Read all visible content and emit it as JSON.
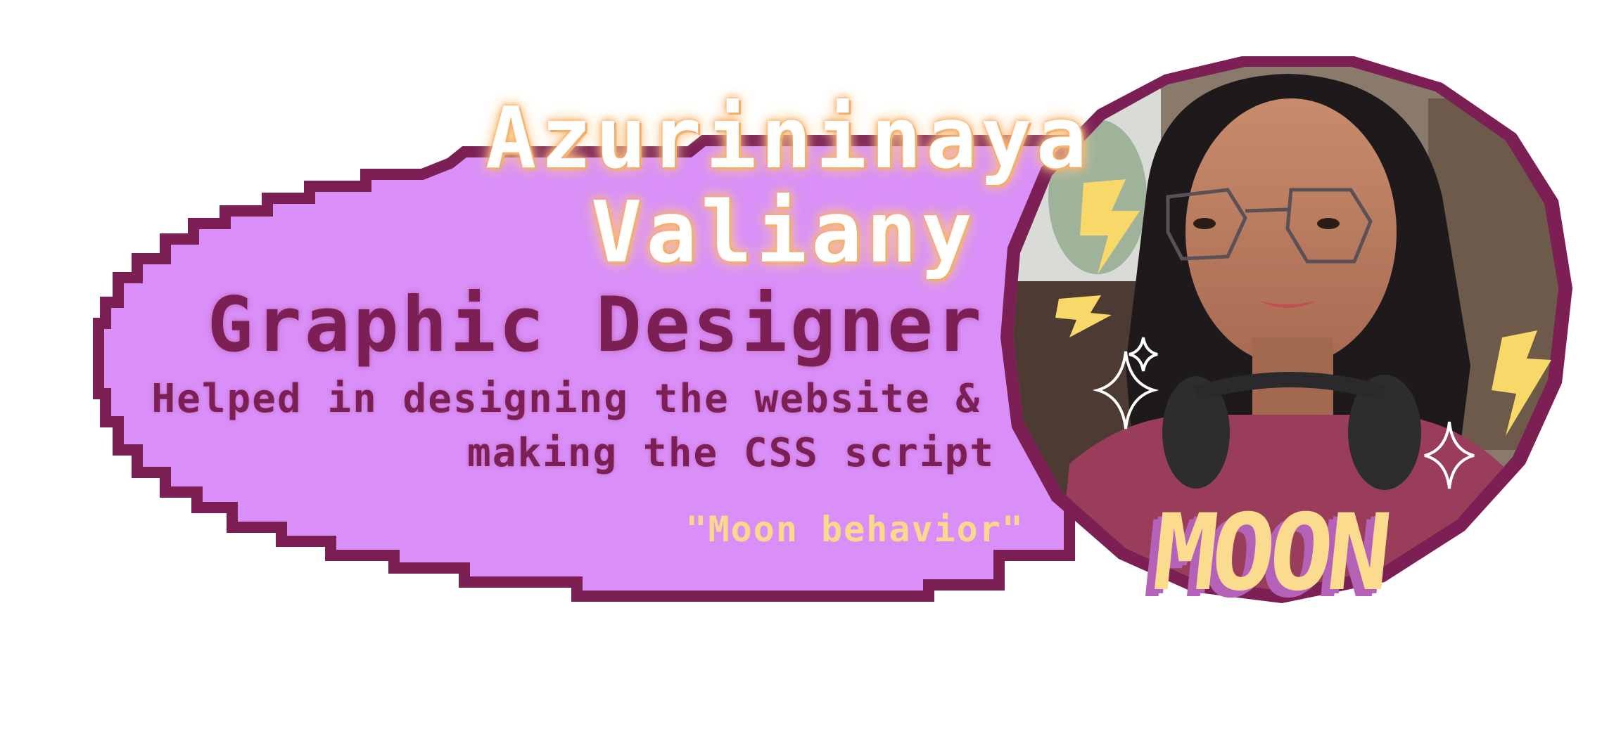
{
  "profile": {
    "name_line1": "Azurininaya",
    "name_line2": "Valiany",
    "role": "Graphic Designer",
    "description_line1": "Helped in designing the website &",
    "description_line2": "making the CSS script",
    "quote": "\"Moon behavior\"",
    "nickname": "MOON"
  },
  "colors": {
    "bubble_fill": "#d98ff7",
    "border": "#7b1f55",
    "accent_yellow": "#fbdc8e",
    "name_glow": "#f5a55a"
  },
  "icons": [
    "lightning-bolt-icon",
    "sparkle-icon"
  ]
}
